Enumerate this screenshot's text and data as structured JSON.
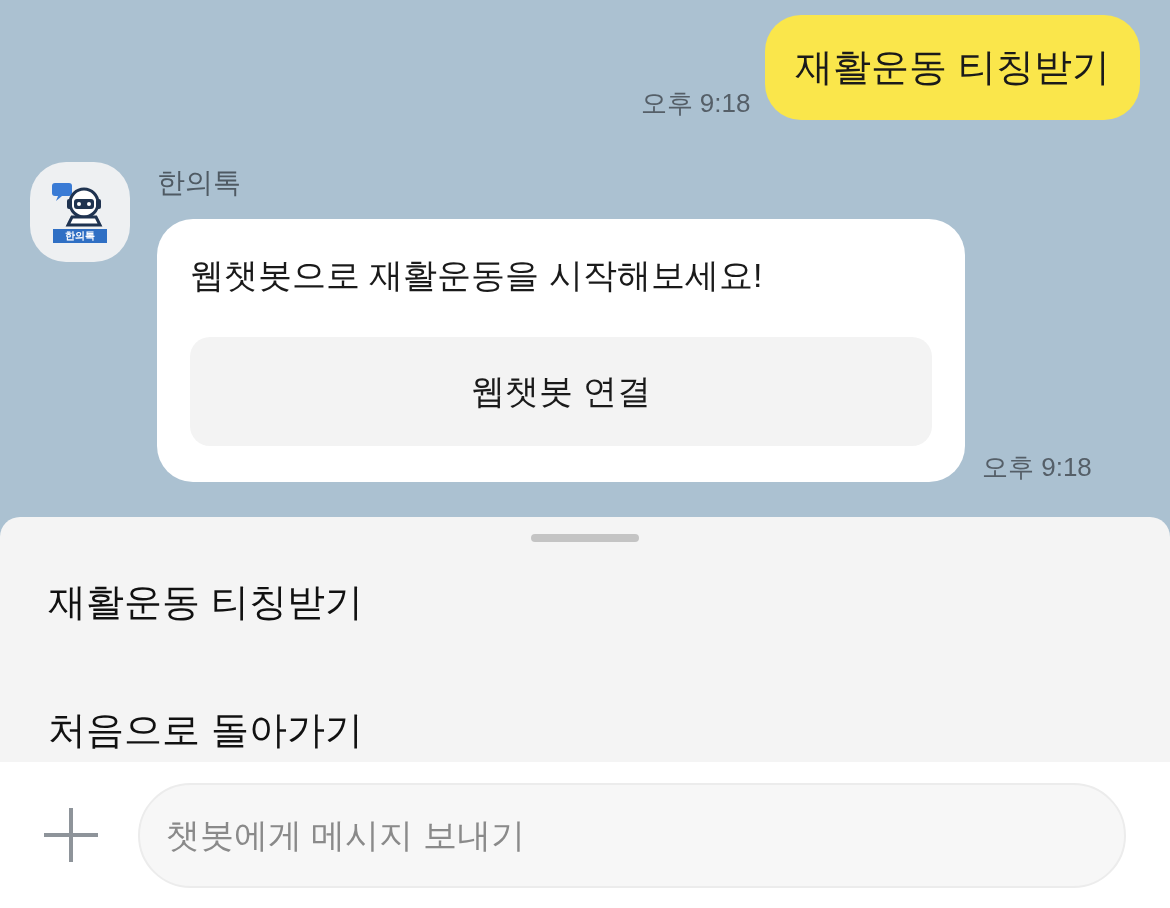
{
  "messages": [
    {
      "kind": "outgoing",
      "text": "재활운동 티칭받기",
      "time": "오후 9:18"
    },
    {
      "kind": "card",
      "sender": "한의톡",
      "avatar_label": "한의톡",
      "text": "웹챗봇으로 재활운동을 시작해보세요!",
      "button": "웹챗봇 연결",
      "time": "오후 9:18"
    }
  ],
  "quick_replies": [
    "재활운동 티칭받기",
    "처음으로 돌아가기"
  ],
  "composer": {
    "placeholder": "챗봇에게 메시지 보내기"
  }
}
